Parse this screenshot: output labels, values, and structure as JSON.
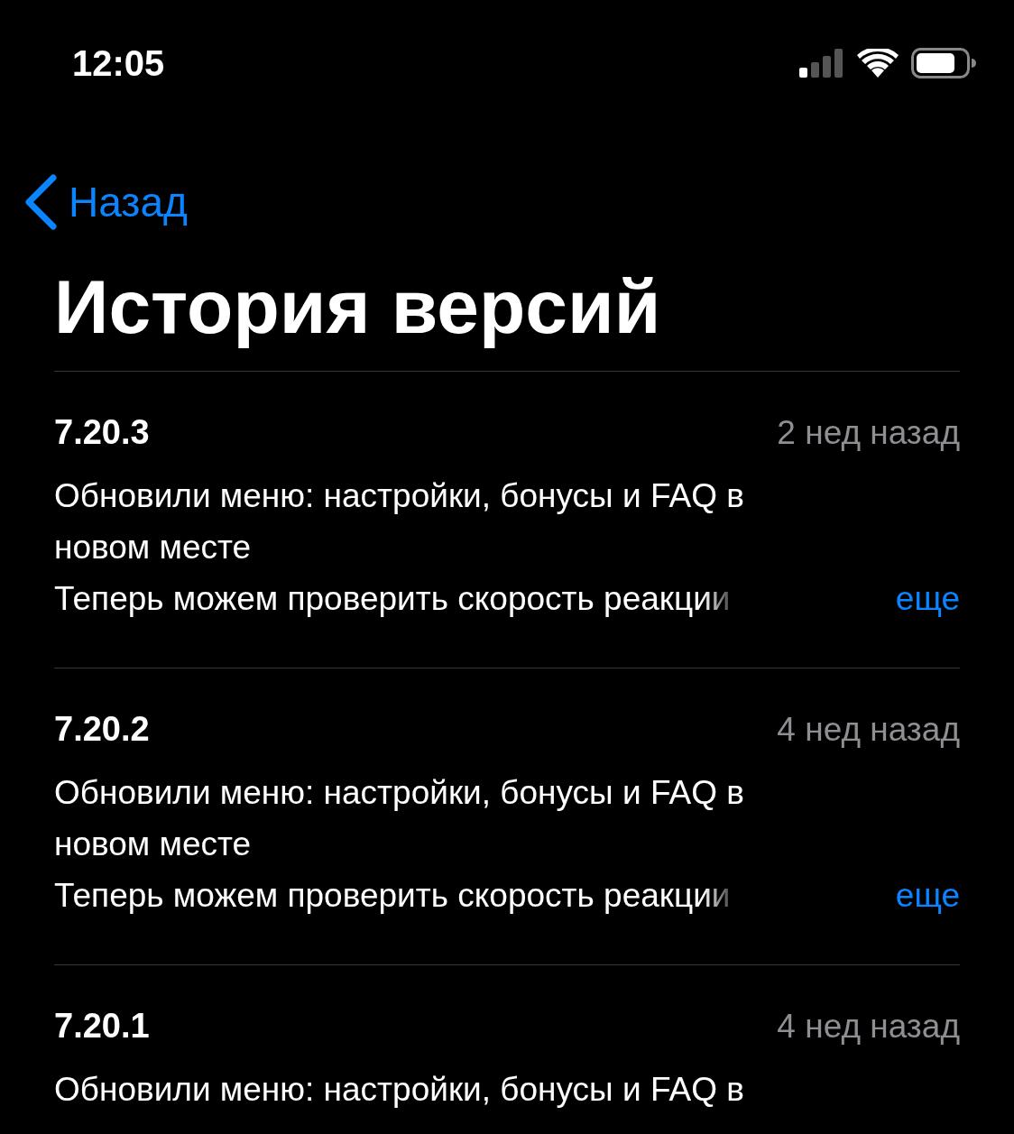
{
  "status_bar": {
    "time": "12:05"
  },
  "nav": {
    "back": "Назад"
  },
  "title": "История версий",
  "versions": [
    {
      "version": "7.20.3",
      "age": "2 нед назад",
      "notes": [
        "Обновили меню: настройки, бонусы и FAQ в новом месте",
        "Теперь можем проверить скорость реакции"
      ],
      "more": "еще"
    },
    {
      "version": "7.20.2",
      "age": "4 нед назад",
      "notes": [
        "Обновили меню: настройки, бонусы и FAQ в новом месте",
        "Теперь можем проверить скорость реакции"
      ],
      "more": "еще"
    },
    {
      "version": "7.20.1",
      "age": "4 нед назад",
      "notes": [
        "Обновили меню: настройки, бонусы и FAQ в"
      ]
    }
  ]
}
